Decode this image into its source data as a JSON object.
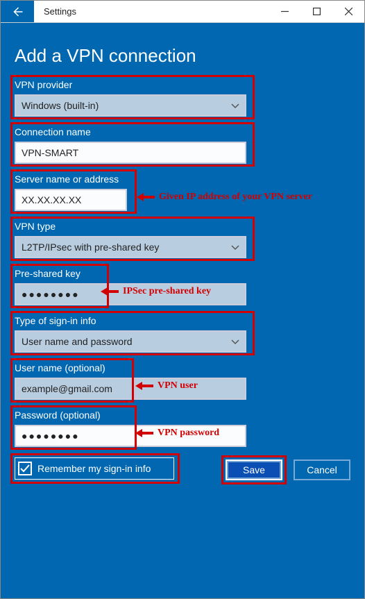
{
  "titlebar": {
    "app_name": "Settings"
  },
  "page": {
    "title": "Add a VPN connection"
  },
  "fields": {
    "provider": {
      "label": "VPN provider",
      "value": "Windows (built-in)"
    },
    "conn_name": {
      "label": "Connection name",
      "value": "VPN-SMART"
    },
    "server": {
      "label": "Server name or address",
      "value": "XX.XX.XX.XX"
    },
    "vpn_type": {
      "label": "VPN type",
      "value": "L2TP/IPsec with pre-shared key"
    },
    "psk": {
      "label": "Pre-shared key",
      "value": "●●●●●●●●"
    },
    "signin": {
      "label": "Type of sign-in info",
      "value": "User name and password"
    },
    "user": {
      "label": "User name (optional)",
      "value": "example@gmail.com"
    },
    "pass": {
      "label": "Password (optional)",
      "value": "●●●●●●●●"
    }
  },
  "remember": {
    "label": "Remember my sign-in info",
    "checked": true
  },
  "buttons": {
    "save": "Save",
    "cancel": "Cancel"
  },
  "annotations": {
    "server": "Given IP address of your VPN server",
    "psk": "IPSec pre-shared key",
    "user": "VPN user",
    "pass": "VPN password"
  }
}
